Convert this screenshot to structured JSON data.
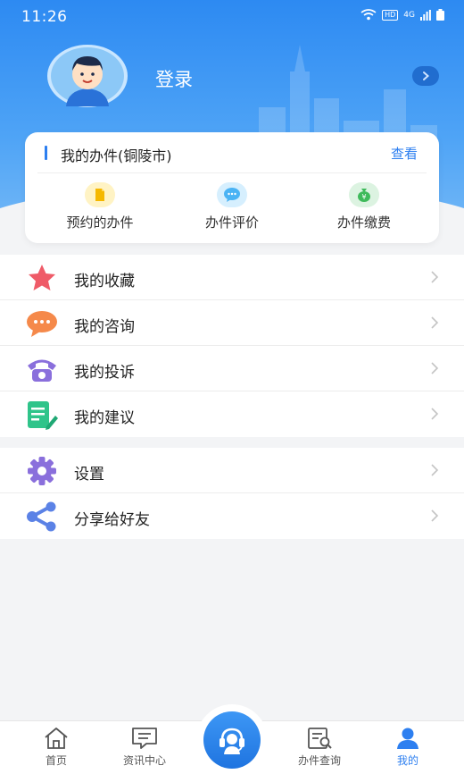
{
  "status_bar": {
    "time": "11:26",
    "network": "HD",
    "signal": "4G"
  },
  "profile": {
    "login_label": "登录"
  },
  "my_affairs": {
    "title": "我的办件(铜陵市)",
    "view_label": "查看",
    "items": [
      {
        "label": "预约的办件",
        "icon": "document-icon",
        "color": "#f5b800"
      },
      {
        "label": "办件评价",
        "icon": "chat-bubble-icon",
        "color": "#4ab3f4"
      },
      {
        "label": "办件缴费",
        "icon": "money-bag-icon",
        "color": "#3fba5b"
      }
    ]
  },
  "menu_group_1": [
    {
      "label": "我的收藏",
      "icon": "star-icon",
      "color": "#ef5b68"
    },
    {
      "label": "我的咨询",
      "icon": "chat-icon",
      "color": "#f5894a"
    },
    {
      "label": "我的投诉",
      "icon": "telephone-icon",
      "color": "#8a6fdc"
    },
    {
      "label": "我的建议",
      "icon": "note-edit-icon",
      "color": "#2fc48a"
    }
  ],
  "menu_group_2": [
    {
      "label": "设置",
      "icon": "gear-icon",
      "color": "#8a6fdc"
    },
    {
      "label": "分享给好友",
      "icon": "share-icon",
      "color": "#5b82e6"
    }
  ],
  "bottom_nav": [
    {
      "label": "首页",
      "icon": "home-icon"
    },
    {
      "label": "资讯中心",
      "icon": "message-icon"
    },
    {
      "label": "",
      "icon": "customer-service-icon"
    },
    {
      "label": "办件查询",
      "icon": "search-document-icon"
    },
    {
      "label": "我的",
      "icon": "user-icon",
      "active": true
    }
  ],
  "colors": {
    "primary": "#2d7ff0",
    "header": "#2d8af2"
  }
}
